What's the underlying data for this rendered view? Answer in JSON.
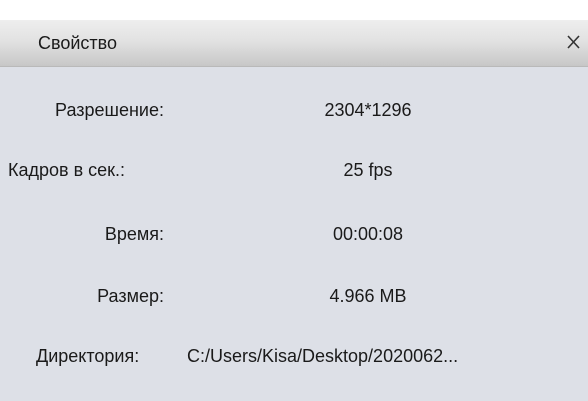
{
  "window": {
    "title": "Свойство",
    "close_icon": "close-icon"
  },
  "properties": [
    {
      "key": "resolution",
      "label": "Разрешение:",
      "value": "2304*1296"
    },
    {
      "key": "fps",
      "label": "Кадров в сек.:",
      "value": "25 fps"
    },
    {
      "key": "time",
      "label": "Время:",
      "value": "00:00:08"
    },
    {
      "key": "size",
      "label": "Размер:",
      "value": "4.966 MB"
    },
    {
      "key": "directory",
      "label": "Директория:",
      "value": "C:/Users/Kisa/Desktop/2020062..."
    }
  ]
}
